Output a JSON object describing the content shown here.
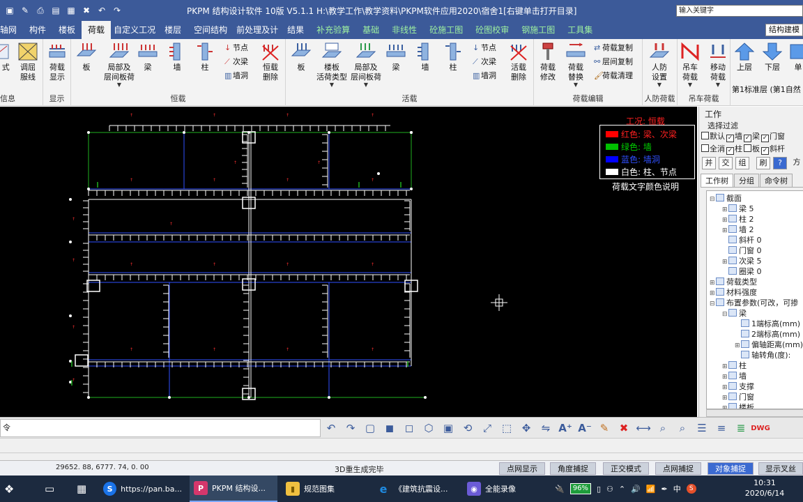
{
  "window": {
    "title": "PKPM 结构设计软件 10版 V5.1.1  H:\\教学工作\\教学资料\\PKPM软件应用2020\\宿舍1[右键单击打开目录]",
    "search_placeholder": "输入关键字"
  },
  "quick_access": [
    "save-icon",
    "edit-icon",
    "print-icon",
    "window-icon",
    "print2-icon",
    "close-file-icon",
    "undo-icon",
    "redo-icon"
  ],
  "menu_tabs": [
    {
      "label": "轴网"
    },
    {
      "label": "构件"
    },
    {
      "label": "楼板"
    },
    {
      "label": "荷载",
      "active": true
    },
    {
      "label": "自定义工况"
    },
    {
      "label": "楼层"
    },
    {
      "label": "空间结构"
    },
    {
      "label": "前处理及计"
    },
    {
      "label": "结果"
    },
    {
      "label": "补充验算",
      "green": true
    },
    {
      "label": "基础",
      "green": true
    },
    {
      "label": "非线性",
      "green": true
    },
    {
      "label": "砼施工图",
      "green": true
    },
    {
      "label": "砼图校审",
      "green": true
    },
    {
      "label": "钢施工图",
      "green": true
    },
    {
      "label": "工具集",
      "green": true
    }
  ],
  "menu_right_button": "结构建模",
  "ribbon": {
    "groups": {
      "info": "信息",
      "display": "显示",
      "dead_load": "恒载",
      "live_load": "活载",
      "load_edit": "荷载编辑",
      "civil_def": "人防荷载",
      "crane": "吊车荷载"
    },
    "buttons": {
      "form": "荷\n式",
      "transfer_layer": "调屈\n服线",
      "load_display": "荷载\n显示",
      "dead_slab": "板",
      "dead_local": "局部及\n层间板荷",
      "dead_beam": "梁",
      "dead_wall": "墙",
      "dead_column": "柱",
      "dead_node": "节点",
      "dead_secbeam": "次梁",
      "dead_opening": "墙洞",
      "dead_delete": "恒载\n删除",
      "live_slab": "板",
      "live_slab_type": "楼板\n活荷类型",
      "live_local": "局部及\n层间板荷",
      "live_beam": "梁",
      "live_wall": "墙",
      "live_column": "柱",
      "live_node": "节点",
      "live_secbeam": "次梁",
      "live_opening": "墙洞",
      "live_delete": "活载\n删除",
      "load_modify": "荷载\n修改",
      "load_replace": "荷载\n替换",
      "load_copy": "荷载复制",
      "layer_copy": "层间复制",
      "load_clear": "荷载清理",
      "civil_set": "人防\n设置",
      "crane_load": "吊车\n荷载",
      "move_load": "移动\n荷载",
      "up_floor": "上层",
      "down_floor": "下层",
      "single": "单",
      "floor_info": "第1标准层  (第1自然"
    }
  },
  "canvas": {
    "legend_title": "工况: 恒载",
    "legend_rows": [
      {
        "color": "#ff0000",
        "text": "红色: 梁、次梁"
      },
      {
        "color": "#00c000",
        "text": "绿色: 墙"
      },
      {
        "color": "#0000ff",
        "text": "蓝色: 墙洞"
      },
      {
        "color": "#ffffff",
        "text": "白色: 柱、节点"
      }
    ],
    "legend_caption": "荷载文字颜色说明"
  },
  "right_panel": {
    "title": "工作",
    "filter_label": "选择过滤",
    "filter_row1": [
      {
        "label": "默认",
        "checked": false
      },
      {
        "label": "墙",
        "checked": true
      },
      {
        "label": "梁",
        "checked": true
      },
      {
        "label": "门窗",
        "checked": true
      }
    ],
    "filter_row2": [
      {
        "label": "全消",
        "checked": false
      },
      {
        "label": "柱",
        "checked": true
      },
      {
        "label": "板",
        "checked": false
      },
      {
        "label": "斜杆",
        "checked": true
      }
    ],
    "tool_buttons": [
      "并",
      "交",
      "组",
      "刷",
      "?",
      "方"
    ],
    "tabs": [
      "工作树",
      "分组",
      "命令树"
    ],
    "tree": [
      {
        "text": "截面",
        "level": 0,
        "exp": "⊟"
      },
      {
        "text": "梁 5",
        "level": 1,
        "exp": "⊞"
      },
      {
        "text": "柱 2",
        "level": 1,
        "exp": "⊞"
      },
      {
        "text": "墙 2",
        "level": 1,
        "exp": "⊞"
      },
      {
        "text": "斜杆 0",
        "level": 1,
        "exp": ""
      },
      {
        "text": "门窗 0",
        "level": 1,
        "exp": ""
      },
      {
        "text": "次梁 5",
        "level": 1,
        "exp": "⊞"
      },
      {
        "text": "圈梁 0",
        "level": 1,
        "exp": ""
      },
      {
        "text": "荷载类型",
        "level": 0,
        "exp": "⊞"
      },
      {
        "text": "材料强度",
        "level": 0,
        "exp": "⊞"
      },
      {
        "text": "布置参数(可改，可掺",
        "level": 0,
        "exp": "⊟"
      },
      {
        "text": "梁",
        "level": 1,
        "exp": "⊟"
      },
      {
        "text": "1端标高(mm)",
        "level": 2,
        "exp": ""
      },
      {
        "text": "2端标高(mm)",
        "level": 2,
        "exp": ""
      },
      {
        "text": "偏轴距离(mm)",
        "level": 2,
        "exp": "⊞"
      },
      {
        "text": "轴转角(度):",
        "level": 2,
        "exp": ""
      },
      {
        "text": "柱",
        "level": 1,
        "exp": "⊞"
      },
      {
        "text": "墙",
        "level": 1,
        "exp": "⊞"
      },
      {
        "text": "支撑",
        "level": 1,
        "exp": "⊞"
      },
      {
        "text": "门窗",
        "level": 1,
        "exp": "⊞"
      },
      {
        "text": "楼板",
        "level": 1,
        "exp": "⊞"
      }
    ]
  },
  "command_line": {
    "prompt": "令"
  },
  "status": {
    "coords": "29652. 88, 6777. 74, 0. 00",
    "message": "3D重生成完毕",
    "buttons": [
      {
        "label": "点网显示",
        "on": false
      },
      {
        "label": "角度捕捉",
        "on": false
      },
      {
        "label": "正交模式",
        "on": false
      },
      {
        "label": "点网捕捉",
        "on": false
      },
      {
        "label": "对象捕捉",
        "on": true
      },
      {
        "label": "显示叉丝",
        "on": false
      }
    ]
  },
  "taskbar": {
    "items": [
      {
        "label": "https://pan.ba...",
        "icon": "S",
        "color": "#1a73e8"
      },
      {
        "label": "PKPM 结构设...",
        "icon": "P",
        "color": "#d4376c",
        "active": true
      },
      {
        "label": "规范图集",
        "icon": "▮",
        "color": "#f0c040"
      },
      {
        "label": "《建筑抗震设...",
        "icon": "e",
        "color": "#1f8ae0"
      },
      {
        "label": "全能录像",
        "icon": "◉",
        "color": "#6b5bd6"
      }
    ],
    "battery": "96%",
    "ime": "中",
    "time": "10:31",
    "date": "2020/6/14"
  }
}
